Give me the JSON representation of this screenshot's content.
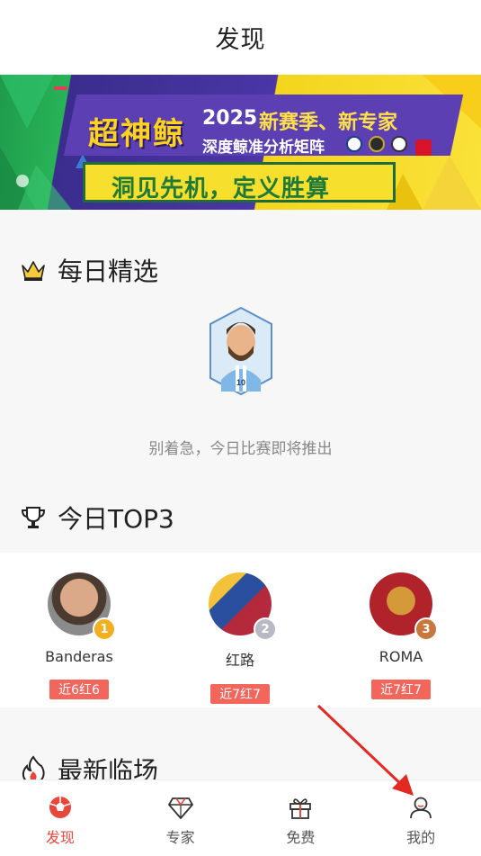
{
  "header": {
    "title": "发现"
  },
  "banner": {
    "brand": "超神鲸",
    "year": "2025",
    "season": "新赛季、新专家",
    "subtitle": "深度鲸准分析矩阵",
    "slogan": "洞见先机，定义胜算"
  },
  "daily": {
    "title": "每日精选",
    "empty_text": "别着急，今日比赛即将推出"
  },
  "top3": {
    "title": "今日TOP3",
    "experts": [
      {
        "name": "Banderas",
        "rank": "1",
        "record": "近6红6"
      },
      {
        "name": "红路",
        "rank": "2",
        "record": "近7红7"
      },
      {
        "name": "ROMA",
        "rank": "3",
        "record": "近7红7"
      }
    ]
  },
  "latest": {
    "title": "最新临场"
  },
  "tabs": [
    {
      "label": "发现",
      "icon": "soccer-ball-icon",
      "active": true
    },
    {
      "label": "专家",
      "icon": "diamond-icon",
      "active": false
    },
    {
      "label": "免费",
      "icon": "gift-icon",
      "active": false
    },
    {
      "label": "我的",
      "icon": "user-icon",
      "active": false
    }
  ],
  "colors": {
    "accent": "#e8473b",
    "tag_bg": "#f2665c",
    "gold": "#f2b021",
    "silver": "#b9b9c4",
    "bronze": "#c9773d"
  }
}
